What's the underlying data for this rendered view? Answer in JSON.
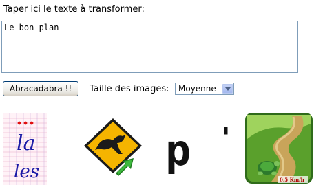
{
  "form": {
    "prompt_label": "Taper ici le texte à transformer:",
    "text_value": "Le bon plan",
    "button_label": "Abracadabra !!",
    "size_label": "Taille des images:",
    "size_selected": "Moyenne"
  },
  "images": [
    {
      "kind": "handwritten-letters-tile",
      "letters": [
        "la",
        "les"
      ]
    },
    {
      "kind": "kangaroo-road-sign-tile"
    },
    {
      "kind": "typed-letter-tile",
      "letters": "p",
      "mark": "'"
    },
    {
      "kind": "turtle-road-tile",
      "speed_label": "0.5 Km/h"
    }
  ],
  "colors": {
    "input_border": "#7f9db9",
    "button_border": "#003c74",
    "sign_yellow": "#f5b400",
    "arrow_green": "#3db83d",
    "grass_green": "#5aa02c",
    "ink_blue": "#1a1aa6"
  }
}
